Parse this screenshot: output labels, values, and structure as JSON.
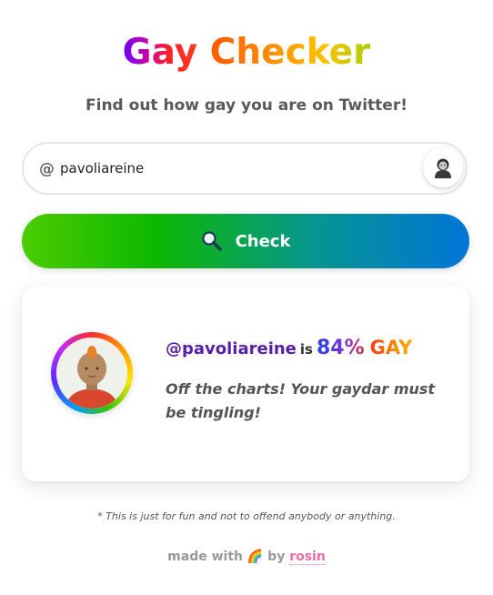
{
  "header": {
    "title_word1": "Gay",
    "title_word2": "Checker",
    "subtitle": "Find out how gay you are on Twitter!"
  },
  "search": {
    "prefix": "@",
    "value": "pavoliareine",
    "avatar_icon": "person-avatar-icon"
  },
  "check_button": {
    "label": "Check",
    "icon": "magnifier-icon"
  },
  "result": {
    "handle": "@pavoliareine",
    "is_word": "is",
    "percent": "84%",
    "gay_word": "GAY",
    "message": "Off the charts! Your gaydar must be tingling!",
    "avatar_icon": "user-avatar-icon"
  },
  "footer": {
    "disclaimer": "* This is just for fun and not to offend anybody or anything.",
    "made_with": "made with",
    "emoji": "🌈",
    "by": "by",
    "author": "rosin"
  },
  "colors": {
    "button_start": "#4ccd00",
    "button_end": "#0074d9",
    "handle": "#5a1fa8",
    "author": "#ee6aa8"
  }
}
